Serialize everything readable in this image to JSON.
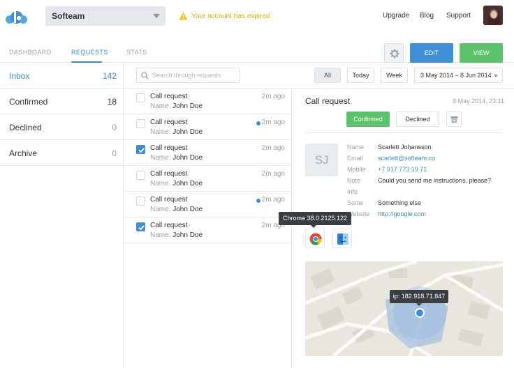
{
  "header": {
    "team": "Softeam",
    "alert": "Your account has expired",
    "nav": [
      "Upgrade",
      "Blog",
      "Support"
    ]
  },
  "tabs": [
    "DASHBOARD",
    "REQUESTS",
    "STATS"
  ],
  "toolbar": {
    "edit": "EDIT",
    "view": "VIEW"
  },
  "sidebar": {
    "items": [
      {
        "label": "Inbox",
        "count": "142"
      },
      {
        "label": "Confirmed",
        "count": "18"
      },
      {
        "label": "Declined",
        "count": "0"
      },
      {
        "label": "Archive",
        "count": "0"
      }
    ]
  },
  "filters": {
    "search_placeholder": "Search through requests",
    "all": "All",
    "today": "Today",
    "week": "Week",
    "range": "3 May 2014 – 8 Jun 2014"
  },
  "list": {
    "name_label": "Name:",
    "rows": [
      {
        "title": "Call request",
        "name": "John Doe",
        "time": "2m ago",
        "checked": false,
        "unread": false
      },
      {
        "title": "Call request",
        "name": "John Doe",
        "time": "2m ago",
        "checked": false,
        "unread": true
      },
      {
        "title": "Call request",
        "name": "John Doe",
        "time": "2m ago",
        "checked": true,
        "unread": false
      },
      {
        "title": "Call request",
        "name": "John Doe",
        "time": "2m ago",
        "checked": false,
        "unread": false
      },
      {
        "title": "Call request",
        "name": "John Doe",
        "time": "2m ago",
        "checked": false,
        "unread": true
      },
      {
        "title": "Call request",
        "name": "John Doe",
        "time": "2m ago",
        "checked": true,
        "unread": false
      }
    ]
  },
  "detail": {
    "title": "Call request",
    "date": "8 May 2014, 23:11",
    "confirmed": "Confirmed",
    "declined": "Declined",
    "initials": "SJ",
    "fields": [
      {
        "label": "Name",
        "value": "Scarlett Johansson",
        "link": false
      },
      {
        "label": "Email",
        "value": "scarlett@softeam.co",
        "link": true
      },
      {
        "label": "Mobile",
        "value": "+7 917 773 19 71",
        "link": true
      },
      {
        "label": "Note",
        "value": "Could you send me instructions, please?",
        "link": false
      },
      {
        "label": "Info",
        "value": "",
        "link": false
      },
      {
        "label": "Some",
        "value": "Something else",
        "link": false
      },
      {
        "label": "Website",
        "value": "http://google.com",
        "link": true
      }
    ],
    "browser_tooltip": "Chrome 38.0.2125.122",
    "ip": "ip: 182.918.71.847"
  },
  "colors": {
    "accent": "#3f8fd8",
    "success": "#5cc26c",
    "warning": "#d4b100"
  }
}
